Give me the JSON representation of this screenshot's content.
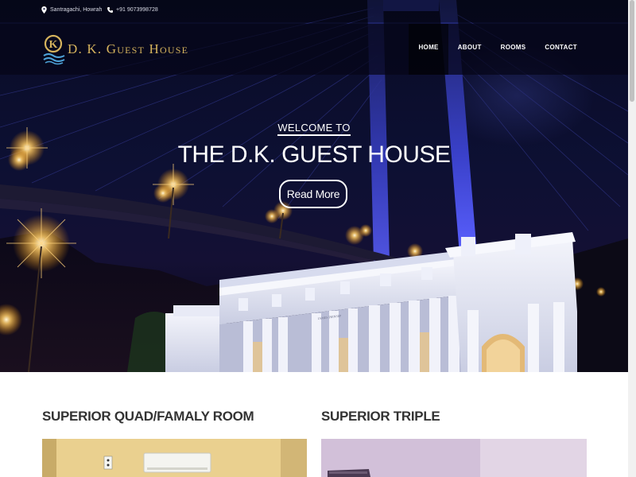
{
  "topbar": {
    "address": "Santragachi, Howrah",
    "phone": "+91 9073998728"
  },
  "brand": {
    "name": "D. K. Guest House",
    "logo_letter": "K"
  },
  "nav": {
    "items": [
      "HOME",
      "ABOUT",
      "ROOMS",
      "CONTACT"
    ],
    "active": "HOME"
  },
  "hero": {
    "welcome": "WELCOME TO",
    "title": "THE D.K. GUEST HOUSE",
    "button": "Read More",
    "monument_inscription": "JAMES PRINSEP"
  },
  "rooms": [
    {
      "title": "SUPERIOR QUAD/FAMALY ROOM"
    },
    {
      "title": "SUPERIOR TRIPLE"
    }
  ],
  "colors": {
    "brand_gold": "#d5b35d",
    "hero_dark": "#0d1033",
    "bridge_cable": "#4a52e6",
    "heading": "#333333"
  }
}
